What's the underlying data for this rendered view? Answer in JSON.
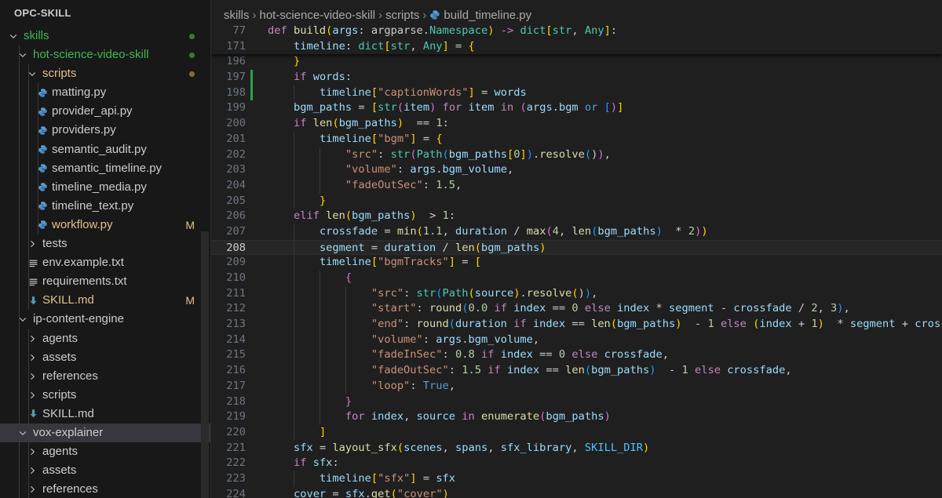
{
  "explorer": {
    "title": "OPC-SKILL",
    "items": [
      {
        "label": "skills",
        "depth": 0,
        "kind": "folder",
        "open": true,
        "color": "#3fb950",
        "status": "dot",
        "status_color": "#3a7a3a"
      },
      {
        "label": "hot-science-video-skill",
        "depth": 1,
        "kind": "folder",
        "open": true,
        "color": "#3fb950",
        "status": "dot",
        "status_color": "#3a7a3a"
      },
      {
        "label": "scripts",
        "depth": 2,
        "kind": "folder",
        "open": true,
        "color": "#e2c08d",
        "status": "dot",
        "status_color": "#8a6a3a"
      },
      {
        "label": "matting.py",
        "depth": 3,
        "kind": "py"
      },
      {
        "label": "provider_api.py",
        "depth": 3,
        "kind": "py"
      },
      {
        "label": "providers.py",
        "depth": 3,
        "kind": "py"
      },
      {
        "label": "semantic_audit.py",
        "depth": 3,
        "kind": "py"
      },
      {
        "label": "semantic_timeline.py",
        "depth": 3,
        "kind": "py"
      },
      {
        "label": "timeline_media.py",
        "depth": 3,
        "kind": "py"
      },
      {
        "label": "timeline_text.py",
        "depth": 3,
        "kind": "py"
      },
      {
        "label": "workflow.py",
        "depth": 3,
        "kind": "py",
        "color": "#e2c08d",
        "status": "M"
      },
      {
        "label": "tests",
        "depth": 2,
        "kind": "folder",
        "open": false
      },
      {
        "label": "env.example.txt",
        "depth": 2,
        "kind": "txt"
      },
      {
        "label": "requirements.txt",
        "depth": 2,
        "kind": "txt"
      },
      {
        "label": "SKILL.md",
        "depth": 2,
        "kind": "md",
        "color": "#e2c08d",
        "status": "M"
      },
      {
        "label": "ip-content-engine",
        "depth": 1,
        "kind": "folder",
        "open": true
      },
      {
        "label": "agents",
        "depth": 2,
        "kind": "folder",
        "open": false
      },
      {
        "label": "assets",
        "depth": 2,
        "kind": "folder",
        "open": false
      },
      {
        "label": "references",
        "depth": 2,
        "kind": "folder",
        "open": false
      },
      {
        "label": "scripts",
        "depth": 2,
        "kind": "folder",
        "open": false
      },
      {
        "label": "SKILL.md",
        "depth": 2,
        "kind": "md"
      },
      {
        "label": "vox-explainer",
        "depth": 1,
        "kind": "folder",
        "open": true,
        "selected": true
      },
      {
        "label": "agents",
        "depth": 2,
        "kind": "folder",
        "open": false
      },
      {
        "label": "assets",
        "depth": 2,
        "kind": "folder",
        "open": false
      },
      {
        "label": "references",
        "depth": 2,
        "kind": "folder",
        "open": false
      }
    ],
    "status_colors": {
      "M": "#e2c08d"
    }
  },
  "breadcrumb": [
    "skills",
    "hot-science-video-skill",
    "scripts",
    "build_timeline.py"
  ],
  "editor": {
    "current_line": "208",
    "lines": [
      {
        "n": "77",
        "sticky": true,
        "ind": 0,
        "code": "[kw]def [fn]build[b1]([va]args[]: argparse.[ty]Namespace[b1]) [kw]-> [ty]dict[b1][[ty]str[], [ty]Any[b1]][]:"
      },
      {
        "n": "171",
        "sticky": true,
        "last": true,
        "ind": 1,
        "code": "    [va]timeline[]: [ty]dict[b1][[ty]str[], [ty]Any[b1]][] = [b1]{"
      },
      {
        "n": "196",
        "ind": 1,
        "code": "    [b1]}"
      },
      {
        "n": "197",
        "ind": 1,
        "gutter": true,
        "code": "    [kw]if [va]words[]:"
      },
      {
        "n": "198",
        "ind": 2,
        "gutter": true,
        "code": "        [va]timeline[b1][[st]\"captionWords\"[b1]][] = [va]words"
      },
      {
        "n": "199",
        "ind": 1,
        "code": "    [va]bgm_paths[] = [b1][[ty]str[b2]([va]item[b2]) [kw]for [va]item [kw]in [b2]([va]args[].[va]bgm [kb]or [b3][][b2])[b1]]"
      },
      {
        "n": "200",
        "ind": 1,
        "code": "    [kw]if [fn]len[b1]([va]bgm_paths[b1]) [] == [nu]1[]:"
      },
      {
        "n": "201",
        "ind": 2,
        "code": "        [va]timeline[b1][[st]\"bgm\"[b1]][] = [b1]{"
      },
      {
        "n": "202",
        "ind": 3,
        "code": "            [st]\"src\"[]: [ty]str[b2]([ty]Path[b3]([va]bgm_paths[b1][[nu]0[b1]][b3])[].[fn]resolve[b3]()[b2])[],"
      },
      {
        "n": "203",
        "ind": 3,
        "code": "            [st]\"volume\"[]: [va]args[].[va]bgm_volume[],"
      },
      {
        "n": "204",
        "ind": 3,
        "code": "            [st]\"fadeOutSec\"[]: [nu]1.5[],"
      },
      {
        "n": "205",
        "ind": 2,
        "code": "        [b1]}"
      },
      {
        "n": "206",
        "ind": 1,
        "code": "    [kw]elif [fn]len[b1]([va]bgm_paths[b1]) [] > [nu]1[]:"
      },
      {
        "n": "207",
        "ind": 2,
        "code": "        [va]crossfade[] = [fn]min[b1]([nu]1.1[], [va]duration[] / [fn]max[b2]([nu]4[], [fn]len[b3]([va]bgm_paths[b3]) [] * [nu]2[b2])[b1])"
      },
      {
        "n": "208",
        "ind": 2,
        "cur": true,
        "code": "        [va]segment[] = [va]duration[] / [fn]len[b1]([va]bgm_paths[b1])"
      },
      {
        "n": "209",
        "ind": 2,
        "code": "        [va]timeline[b1][[st]\"bgmTracks\"[b1]][] = [b1]["
      },
      {
        "n": "210",
        "ind": 3,
        "code": "            [b2]{"
      },
      {
        "n": "211",
        "ind": 4,
        "code": "                [st]\"src\"[]: [ty]str[b3]([ty]Path[b1]([va]source[b1])[].[fn]resolve[b1]()[b3])[],"
      },
      {
        "n": "212",
        "ind": 4,
        "code": "                [st]\"start\"[]: [fn]round[b3]([nu]0.0 [kw]if [va]index[] == [nu]0 [kw]else [va]index[] * [va]segment[] - [va]crossfade[] / [nu]2[], [nu]3[b3])[],"
      },
      {
        "n": "213",
        "ind": 4,
        "code": "                [st]\"end\"[]: [fn]round[b3]([va]duration [kw]if [va]index[] == [fn]len[b1]([va]bgm_paths[b1]) [] - [nu]1 [kw]else [b1]([va]index[] + [nu]1[b1]) [] * [va]segment[] + [va]crossfade[] /"
      },
      {
        "n": "214",
        "ind": 4,
        "code": "                [st]\"volume\"[]: [va]args[].[va]bgm_volume[],"
      },
      {
        "n": "215",
        "ind": 4,
        "code": "                [st]\"fadeInSec\"[]: [nu]0.8 [kw]if [va]index[] == [nu]0 [kw]else [va]crossfade[],"
      },
      {
        "n": "216",
        "ind": 4,
        "code": "                [st]\"fadeOutSec\"[]: [nu]1.5 [kw]if [va]index[] == [fn]len[b3]([va]bgm_paths[b3]) [] - [nu]1 [kw]else [va]crossfade[],"
      },
      {
        "n": "217",
        "ind": 4,
        "code": "                [st]\"loop\"[]: [kb]True[],"
      },
      {
        "n": "218",
        "ind": 3,
        "code": "            [b2]}"
      },
      {
        "n": "219",
        "ind": 3,
        "code": "            [kw]for [va]index[], [va]source [kw]in [fn]enumerate[b2]([va]bgm_paths[b2])"
      },
      {
        "n": "220",
        "ind": 2,
        "code": "        [b1]]"
      },
      {
        "n": "221",
        "ind": 1,
        "code": "    [va]sfx[] = [fn]layout_sfx[b1]([va]scenes[], [va]spans[], [va]sfx_library[], [cn]SKILL_DIR[b1])"
      },
      {
        "n": "222",
        "ind": 1,
        "code": "    [kw]if [va]sfx[]:"
      },
      {
        "n": "223",
        "ind": 2,
        "code": "        [va]timeline[b1][[st]\"sfx\"[b1]][] = [va]sfx"
      },
      {
        "n": "224",
        "ind": 1,
        "code": "    [va]cover[] = [va]sfx[].[fn]get[b1]([st]\"cover\"[b1])"
      }
    ]
  },
  "colors": {
    "bg": "#1f1f1f",
    "sidebar_bg": "#181818",
    "selected_row": "#37373d",
    "git_added": "#3fb950",
    "git_modified": "#e2c08d"
  },
  "icons": {
    "python_file": "python-icon",
    "markdown_file": "markdown-arrow-icon",
    "text_file": "lines-icon",
    "folder_open": "chevron-down-icon",
    "folder_closed": "chevron-right-icon"
  }
}
